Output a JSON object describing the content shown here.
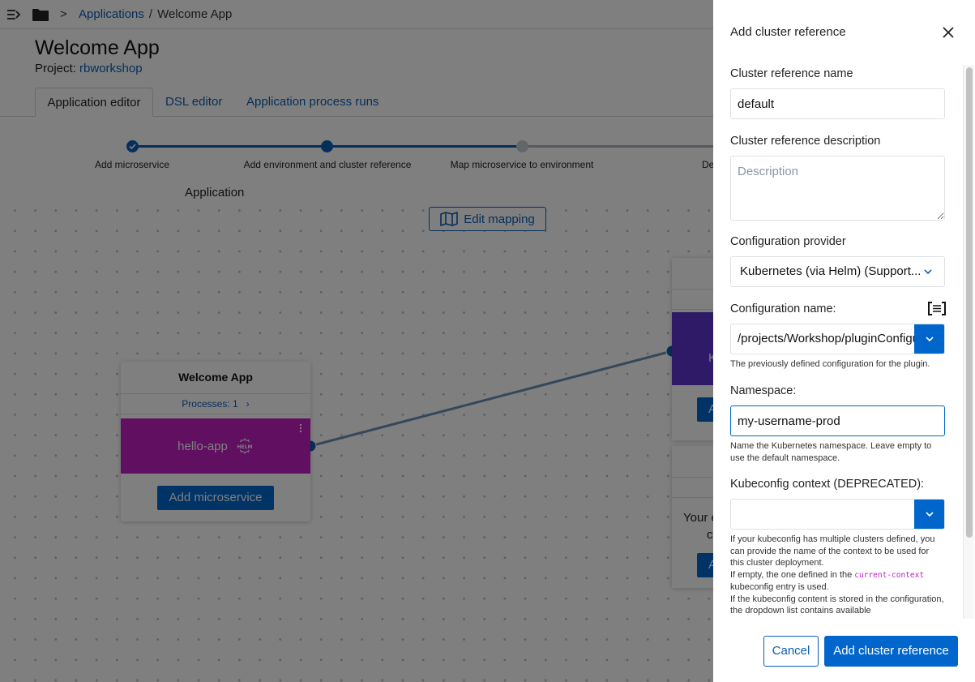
{
  "topbar": {
    "menu_icon": "menu-collapse-icon",
    "folder_icon": "folder-icon",
    "breadcrumb_sep": ">",
    "breadcrumb": [
      {
        "label": "Applications",
        "link": true
      },
      {
        "label": "/",
        "link": false
      },
      {
        "label": "Welcome App",
        "link": false
      }
    ]
  },
  "header": {
    "title": "Welcome App",
    "project_label": "Project:",
    "project_name": "rbworkshop"
  },
  "tabs": [
    {
      "label": "Application editor",
      "active": true
    },
    {
      "label": "DSL editor",
      "active": false
    },
    {
      "label": "Application process runs",
      "active": false
    }
  ],
  "stepper": {
    "steps": [
      {
        "label": "Add microservice",
        "state": "complete"
      },
      {
        "label": "Add environment and cluster reference",
        "state": "current"
      },
      {
        "label": "Map microservice to environment",
        "state": "pending"
      },
      {
        "label": "De",
        "state": "pending"
      }
    ]
  },
  "canvas": {
    "section_label": "Application",
    "edit_mapping_label": "Edit mapping",
    "app_card": {
      "title": "Welcome App",
      "processes_label": "Processes: 1",
      "microservice": {
        "name": "hello-app",
        "type_icon": "helm-icon",
        "color": "#c21fc2"
      },
      "add_button": "Add microservice"
    },
    "env_card_1": {
      "cluster_text_fragment": "K",
      "cluster_color": "#5c35cc",
      "button_fragment": "A"
    },
    "env_card_2": {
      "message_fragment_1": "Your e",
      "message_fragment_2": "c",
      "button_fragment": "A"
    }
  },
  "drawer": {
    "title": "Add cluster reference",
    "fields": {
      "name": {
        "label": "Cluster reference name",
        "value": "default"
      },
      "description": {
        "label": "Cluster reference description",
        "value": "",
        "placeholder": "Description"
      },
      "provider": {
        "label": "Configuration provider",
        "value": "Kubernetes (via Helm) (Support..."
      },
      "config_name": {
        "label": "Configuration name:",
        "value": "/projects/Workshop/pluginConfigurations/",
        "help": "The previously defined configuration for the plugin."
      },
      "namespace": {
        "label": "Namespace:",
        "value": "my-username-prod",
        "help": "Name the Kubernetes namespace. Leave empty to use the default namespace."
      },
      "kubeconfig_context": {
        "label": "Kubeconfig context (DEPRECATED):",
        "value": "",
        "help_1": "If your kubeconfig has multiple clusters defined, you can provide the name of the context to be used for this cluster deployment.",
        "help_2a": "If empty, the one defined in the",
        "help_2_code": "current-context",
        "help_2b": "kubeconfig entry is used.",
        "help_3": "If the kubeconfig content is stored in the configuration, the dropdown list contains available"
      }
    },
    "cancel_label": "Cancel",
    "submit_label": "Add cluster reference"
  },
  "colors": {
    "primary": "#0066cc",
    "link": "#0b5fb5",
    "microservice": "#c21fc2",
    "cluster": "#5c35cc",
    "code": "#c21fc2"
  }
}
